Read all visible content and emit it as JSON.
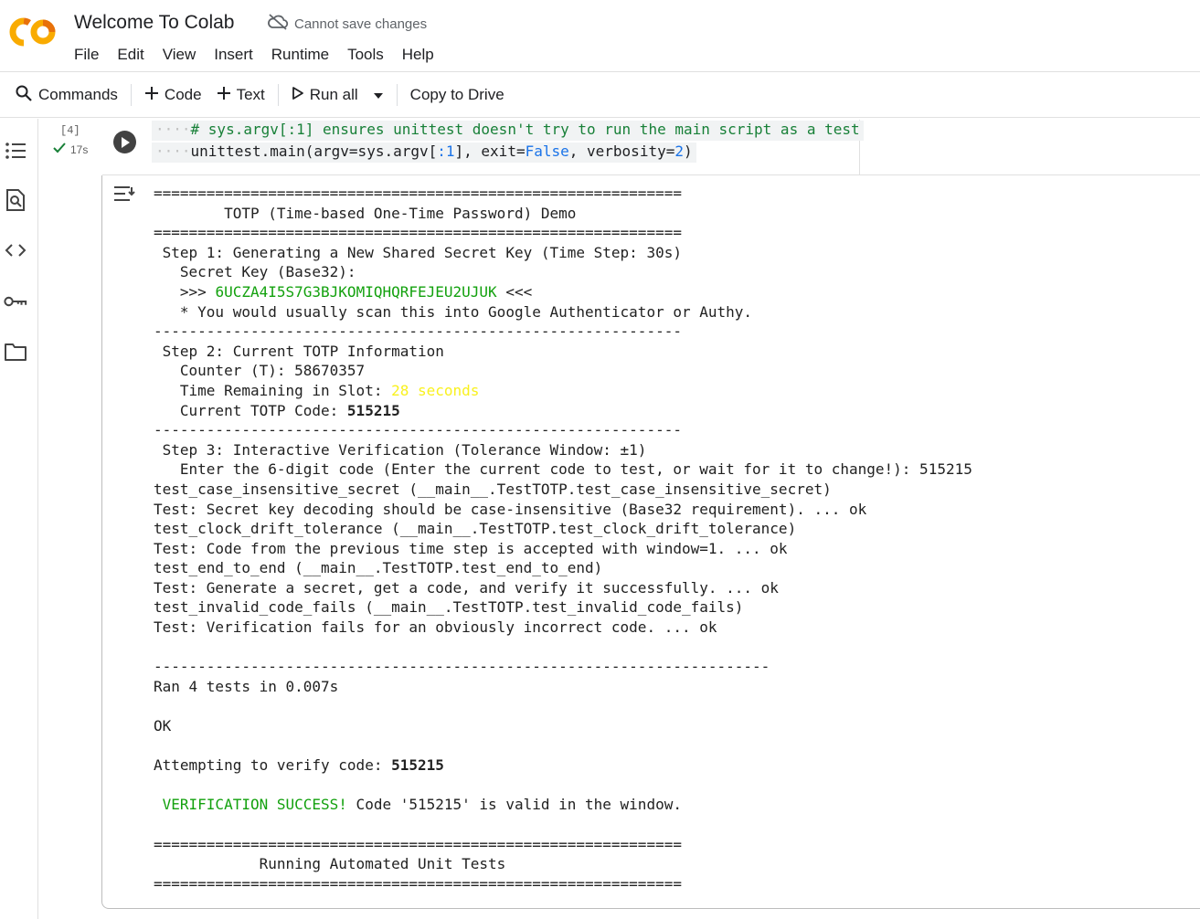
{
  "app": {
    "title": "Welcome To Colab",
    "save_status": "Cannot save changes",
    "logo_text": "CO",
    "brand_colors": {
      "orange": "#F9AB00",
      "dark_orange": "#E8710A"
    }
  },
  "menu": [
    "File",
    "Edit",
    "View",
    "Insert",
    "Runtime",
    "Tools",
    "Help"
  ],
  "toolbar": {
    "commands": "Commands",
    "code": "Code",
    "text": "Text",
    "run_all": "Run all",
    "copy_to_drive": "Copy to Drive"
  },
  "rail": {
    "icons": [
      "table-of-contents-icon",
      "find-icon",
      "code-snippets-icon",
      "secrets-key-icon",
      "files-folder-icon"
    ]
  },
  "cell": {
    "execution_count": "[4]",
    "execution_time": "17s",
    "code_line1": {
      "comment": "# sys.argv[:1] ensures unittest doesn't try to run the main script as a test"
    },
    "code_line2": {
      "pre": "unittest.main(argv=sys.argv[",
      "slice": ":1",
      "mid": "], exit=",
      "false_kw": "False",
      "mid2": ", verbosity=",
      "num": "2",
      "end": ")"
    }
  },
  "output": {
    "sep_eq": "============================================================",
    "sep_dash": "------------------------------------------------------------",
    "sep_dash_long": "----------------------------------------------------------------------",
    "demo_title": "        TOTP (Time-based One-Time Password) Demo",
    "step1": " Step 1: Generating a New Shared Secret Key (Time Step: 30s)",
    "secret_key_label": "   Secret Key (Base32):",
    "key_prefix": "   >>> ",
    "secret_key": "6UCZA4I5S7G3BJKOMIQHQRFEJEU2UJUK",
    "key_suffix": " <<<",
    "scan_note": "   * You would usually scan this into Google Authenticator or Authy.",
    "step2": " Step 2: Current TOTP Information",
    "counter": "   Counter (T): 58670357",
    "time_remaining_label": "   Time Remaining in Slot: ",
    "time_remaining_value": "28 seconds",
    "current_code_label": "   Current TOTP Code: ",
    "current_code": "515215",
    "step3": " Step 3: Interactive Verification (Tolerance Window: ±1)",
    "enter_code": "   Enter the 6-digit code (Enter the current code to test, or wait for it to change!): 515215",
    "tests": [
      "test_case_insensitive_secret (__main__.TestTOTP.test_case_insensitive_secret)",
      "Test: Secret key decoding should be case-insensitive (Base32 requirement). ... ok",
      "test_clock_drift_tolerance (__main__.TestTOTP.test_clock_drift_tolerance)",
      "Test: Code from the previous time step is accepted with window=1. ... ok",
      "test_end_to_end (__main__.TestTOTP.test_end_to_end)",
      "Test: Generate a secret, get a code, and verify it successfully. ... ok",
      "test_invalid_code_fails (__main__.TestTOTP.test_invalid_code_fails)",
      "Test: Verification fails for an obviously incorrect code. ... ok"
    ],
    "ran_tests": "Ran 4 tests in 0.007s",
    "ok": "OK",
    "attempt_label": "Attempting to verify code: ",
    "attempt_code": "515215",
    "success_label": " VERIFICATION SUCCESS!",
    "success_rest": " Code '515215' is valid in the window.",
    "unit_tests_title": "            Running Automated Unit Tests"
  }
}
